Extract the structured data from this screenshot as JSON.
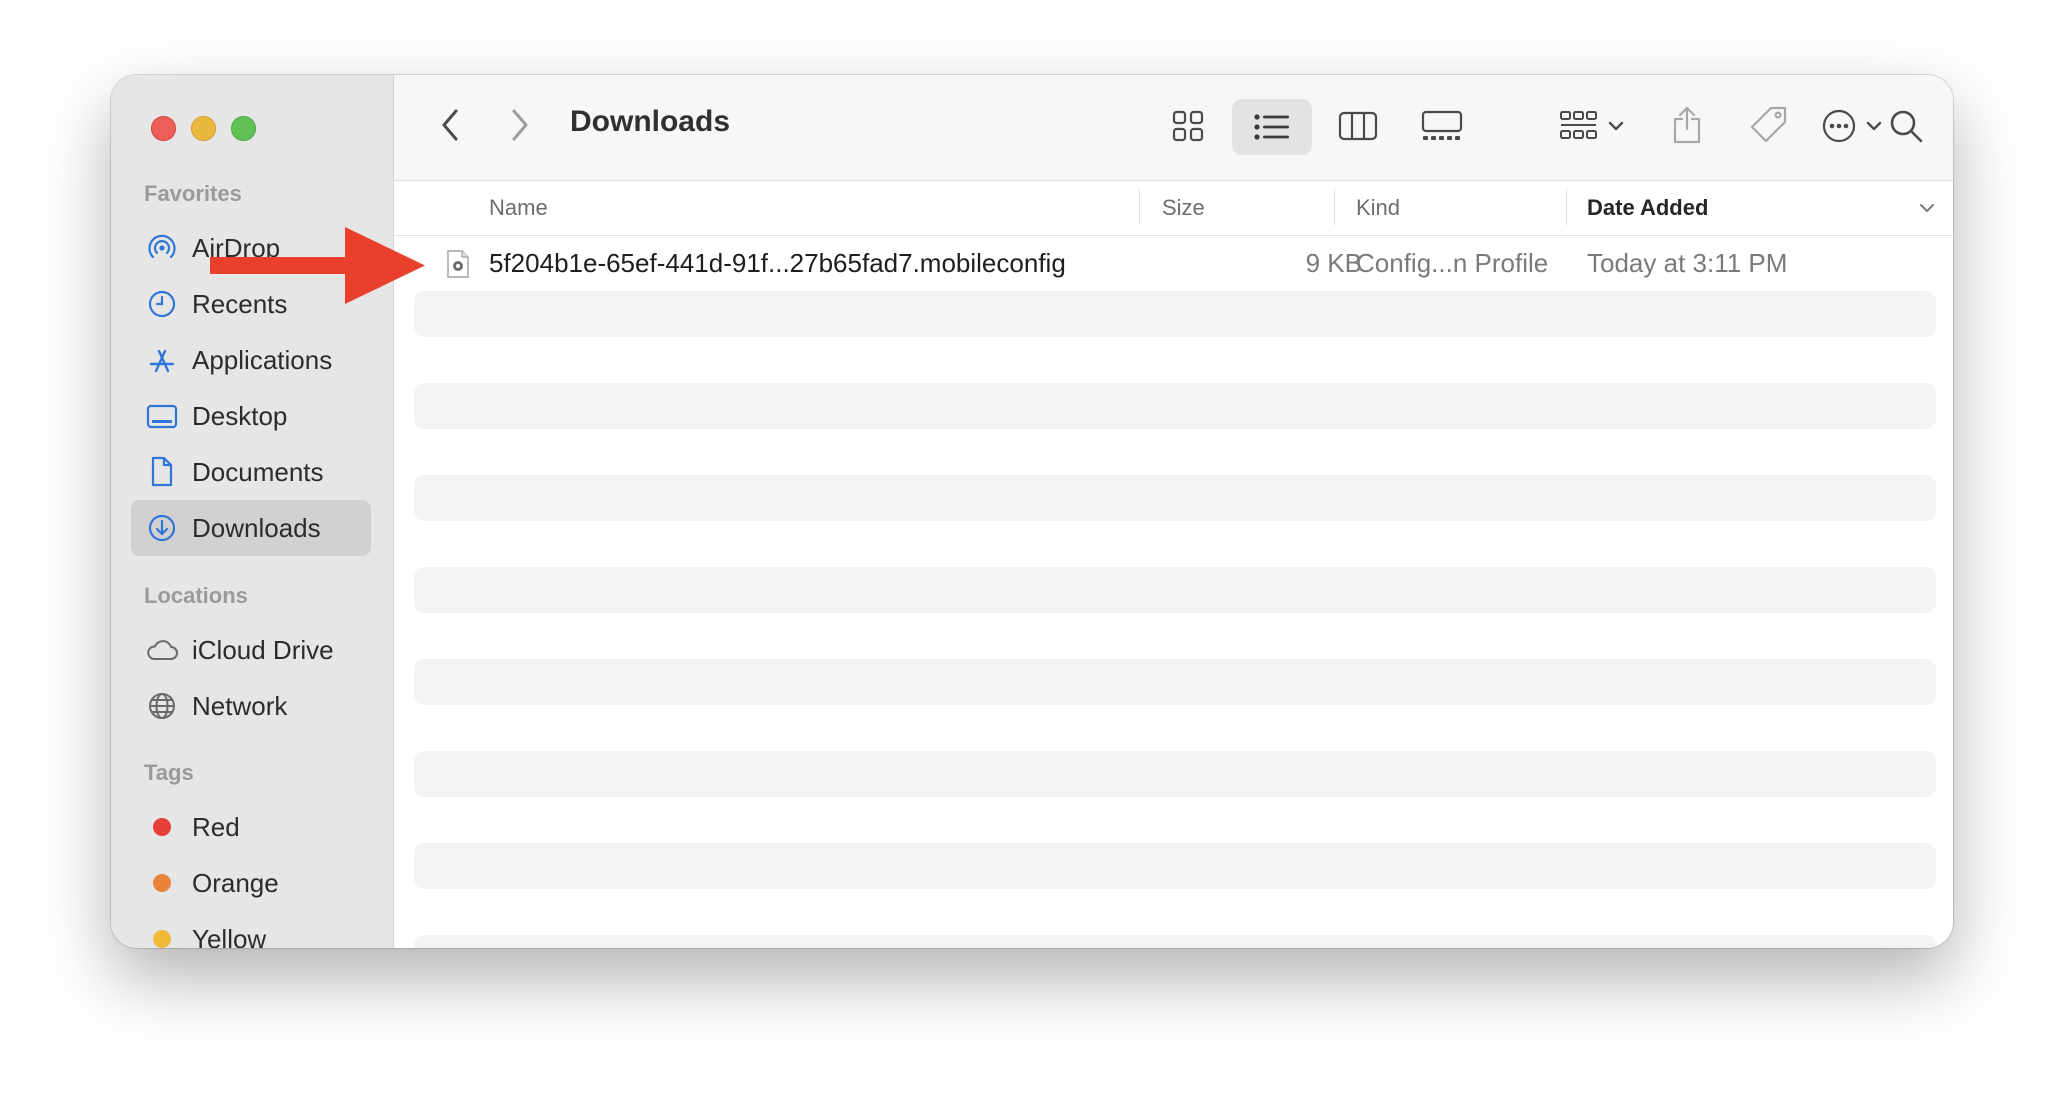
{
  "sidebar": {
    "favorites_heading": "Favorites",
    "favorites": [
      {
        "label": "AirDrop",
        "icon": "airdrop-icon"
      },
      {
        "label": "Recents",
        "icon": "clock-icon"
      },
      {
        "label": "Applications",
        "icon": "applications-icon"
      },
      {
        "label": "Desktop",
        "icon": "desktop-icon"
      },
      {
        "label": "Documents",
        "icon": "document-icon"
      },
      {
        "label": "Downloads",
        "icon": "downloads-icon",
        "selected": true
      }
    ],
    "locations_heading": "Locations",
    "locations": [
      {
        "label": "iCloud Drive",
        "icon": "cloud-icon"
      },
      {
        "label": "Network",
        "icon": "globe-icon"
      }
    ],
    "tags_heading": "Tags",
    "tags": [
      {
        "label": "Red",
        "color": "#e5403a"
      },
      {
        "label": "Orange",
        "color": "#e8843a"
      },
      {
        "label": "Yellow",
        "color": "#f0b93a"
      }
    ]
  },
  "toolbar": {
    "title": "Downloads",
    "selected_view": "list"
  },
  "columns": {
    "name": "Name",
    "size": "Size",
    "kind": "Kind",
    "date_added": "Date Added"
  },
  "files": [
    {
      "name": "5f204b1e-65ef-441d-91f...27b65fad7.mobileconfig",
      "size": "9 KB",
      "kind": "Config...n Profile",
      "date_added": "Today at 3:11 PM"
    }
  ],
  "colors": {
    "accent": "#2f76d9",
    "arrow": "#e8402c",
    "sidebar_bg": "#e7e6e6"
  }
}
